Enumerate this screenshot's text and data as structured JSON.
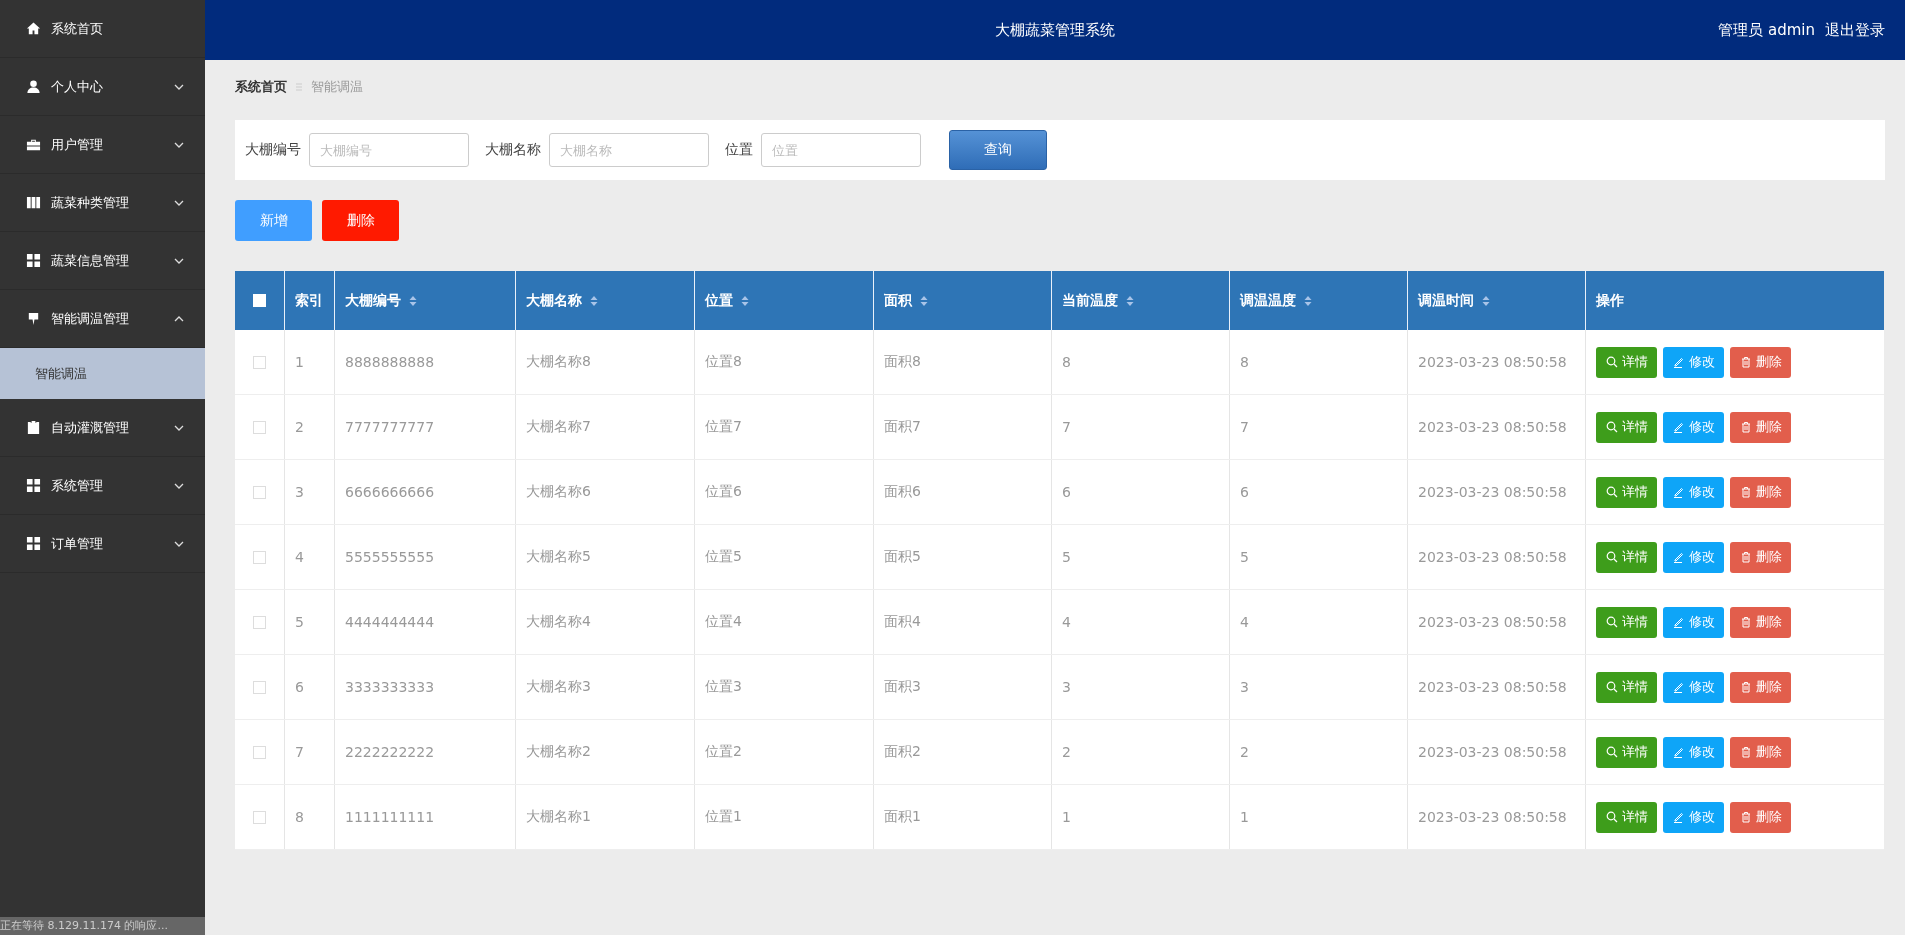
{
  "header": {
    "title": "大棚蔬菜管理系统",
    "user": "管理员 admin",
    "logout": "退出登录"
  },
  "sidebar": {
    "items": [
      {
        "label": "系统首页"
      },
      {
        "label": "个人中心",
        "expanded": false
      },
      {
        "label": "用户管理",
        "expanded": false
      },
      {
        "label": "蔬菜种类管理",
        "expanded": false
      },
      {
        "label": "蔬菜信息管理",
        "expanded": false
      },
      {
        "label": "智能调温管理",
        "expanded": true,
        "children": [
          {
            "label": "智能调温",
            "selected": true
          }
        ]
      },
      {
        "label": "自动灌溉管理",
        "expanded": false
      },
      {
        "label": "系统管理",
        "expanded": false
      },
      {
        "label": "订单管理",
        "expanded": false
      }
    ]
  },
  "breadcrumb": [
    "系统首页",
    "智能调温"
  ],
  "search": {
    "fields": [
      {
        "label": "大棚编号",
        "placeholder": "大棚编号"
      },
      {
        "label": "大棚名称",
        "placeholder": "大棚名称"
      },
      {
        "label": "位置",
        "placeholder": "位置"
      }
    ],
    "button": "查询"
  },
  "actions": {
    "add": "新增",
    "delete": "删除"
  },
  "table": {
    "select_all": {
      "checked": false
    },
    "columns": [
      {
        "label": "索引"
      },
      {
        "label": "大棚编号",
        "sortable": true
      },
      {
        "label": "大棚名称",
        "sortable": true
      },
      {
        "label": "位置",
        "sortable": true
      },
      {
        "label": "面积",
        "sortable": true
      },
      {
        "label": "当前温度",
        "sortable": true
      },
      {
        "label": "调温温度",
        "sortable": true
      },
      {
        "label": "调温时间",
        "sortable": true
      },
      {
        "label": "操作"
      }
    ],
    "rows": [
      {
        "checked": false,
        "cells": [
          "1",
          "8888888888",
          "大棚名称8",
          "位置8",
          "面积8",
          "8",
          "8",
          "2023-03-23 08:50:58"
        ],
        "buttons": [
          "详情",
          "修改",
          "删除"
        ]
      },
      {
        "checked": false,
        "cells": [
          "2",
          "7777777777",
          "大棚名称7",
          "位置7",
          "面积7",
          "7",
          "7",
          "2023-03-23 08:50:58"
        ],
        "buttons": [
          "详情",
          "修改",
          "删除"
        ]
      },
      {
        "checked": false,
        "cells": [
          "3",
          "6666666666",
          "大棚名称6",
          "位置6",
          "面积6",
          "6",
          "6",
          "2023-03-23 08:50:58"
        ],
        "buttons": [
          "详情",
          "修改",
          "删除"
        ]
      },
      {
        "checked": false,
        "cells": [
          "4",
          "5555555555",
          "大棚名称5",
          "位置5",
          "面积5",
          "5",
          "5",
          "2023-03-23 08:50:58"
        ],
        "buttons": [
          "详情",
          "修改",
          "删除"
        ]
      },
      {
        "checked": false,
        "cells": [
          "5",
          "4444444444",
          "大棚名称4",
          "位置4",
          "面积4",
          "4",
          "4",
          "2023-03-23 08:50:58"
        ],
        "buttons": [
          "详情",
          "修改",
          "删除"
        ]
      },
      {
        "checked": false,
        "cells": [
          "6",
          "3333333333",
          "大棚名称3",
          "位置3",
          "面积3",
          "3",
          "3",
          "2023-03-23 08:50:58"
        ],
        "buttons": [
          "详情",
          "修改",
          "删除"
        ]
      },
      {
        "checked": false,
        "cells": [
          "7",
          "2222222222",
          "大棚名称2",
          "位置2",
          "面积2",
          "2",
          "2",
          "2023-03-23 08:50:58"
        ],
        "buttons": [
          "详情",
          "修改",
          "删除"
        ]
      },
      {
        "checked": false,
        "cells": [
          "8",
          "1111111111",
          "大棚名称1",
          "位置1",
          "面积1",
          "1",
          "1",
          "2023-03-23 08:50:58"
        ],
        "buttons": [
          "详情",
          "修改",
          "删除"
        ]
      }
    ]
  },
  "status_bar": "正在等待 8.129.11.174 的响应..."
}
